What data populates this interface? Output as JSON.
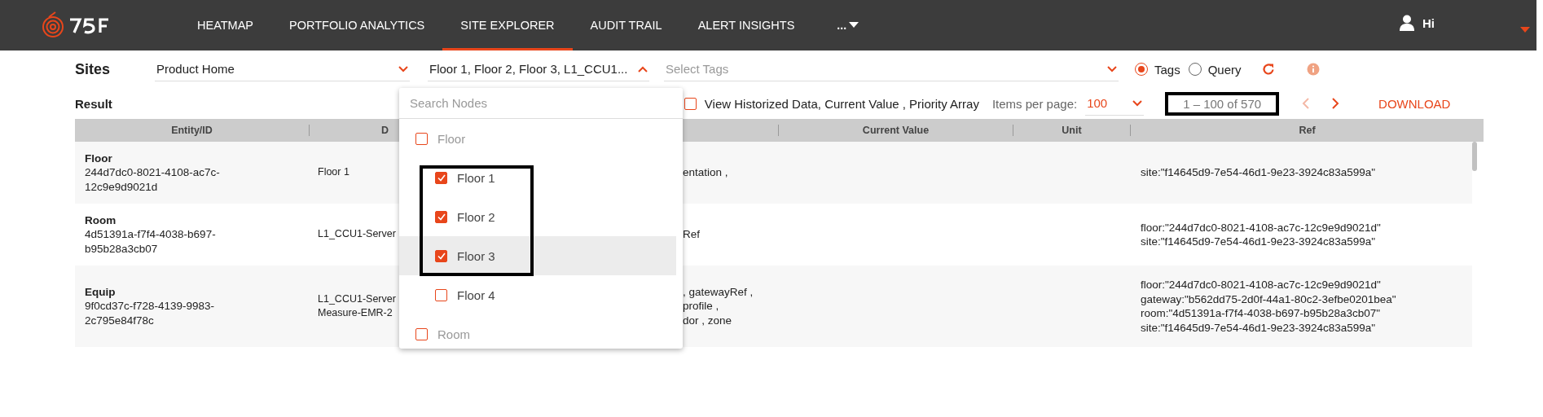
{
  "nav": {
    "items": [
      {
        "label": "HEATMAP",
        "selected": false,
        "kind": "link"
      },
      {
        "label": "PORTFOLIO ANALYTICS",
        "selected": false,
        "kind": "link"
      },
      {
        "label": "SITE EXPLORER",
        "selected": true,
        "kind": "link"
      },
      {
        "label": "AUDIT TRAIL",
        "selected": false,
        "kind": "link"
      },
      {
        "label": "ALERT INSIGHTS",
        "selected": false,
        "kind": "link"
      },
      {
        "label": "...",
        "selected": false,
        "kind": "more"
      }
    ],
    "user": "Hi"
  },
  "filters": {
    "title": "Sites",
    "site": "Product Home",
    "nodes": {
      "value": "Floor 1, Floor 2, Floor 3, L1_CCU1...",
      "expanded": true
    },
    "tags": {
      "placeholder": "Select Tags"
    },
    "modes": [
      {
        "label": "Tags",
        "selected": true
      },
      {
        "label": "Query",
        "selected": false
      }
    ]
  },
  "result": {
    "title": "Result",
    "historized": {
      "label": "View Historized Data, Current Value , Priority Array",
      "checked": false
    },
    "items_per_page": {
      "label": "Items per page:",
      "value": "100"
    },
    "range": "1 – 100 of 570",
    "prev_disabled": true,
    "download": "DOWNLOAD"
  },
  "node_dropdown": {
    "search": {
      "placeholder": "Search Nodes"
    },
    "options": [
      {
        "label": "Floor",
        "checked": false,
        "children": [
          {
            "label": "Floor 1",
            "checked": true,
            "highlighted": false
          },
          {
            "label": "Floor 2",
            "checked": true,
            "highlighted": false
          },
          {
            "label": "Floor 3",
            "checked": true,
            "highlighted": true
          },
          {
            "label": "Floor 4",
            "checked": false,
            "highlighted": false
          }
        ]
      },
      {
        "label": "Room",
        "checked": false
      }
    ]
  },
  "table": {
    "columns": {
      "entity": "Entity/ID",
      "column_2": "D",
      "current_value": "Current Value",
      "unit": "Unit",
      "ref": "Ref"
    },
    "rows": [
      {
        "type": "Floor",
        "id": "244d7dc0-8021-4108-ac7c-12c9e9d9021d",
        "column_2": [
          "Floor 1"
        ],
        "column_3": [
          "entation ,"
        ],
        "ref": [
          "site:\"f14645d9-7e54-46d1-9e23-3924c83a599a\""
        ]
      },
      {
        "type": "Room",
        "id": "4d51391a-f7f4-4038-b697-b95b28a3cb07",
        "column_2": [
          "L1_CCU1-Server"
        ],
        "column_3": [
          "Ref"
        ],
        "ref": [
          "floor:\"244d7dc0-8021-4108-ac7c-12c9e9d9021d\"",
          "site:\"f14645d9-7e54-46d1-9e23-3924c83a599a\""
        ]
      },
      {
        "type": "Equip",
        "id": "9f0cd37c-f728-4139-9983-2c795e84f78c",
        "column_2": [
          "L1_CCU1-Server",
          "Measure-EMR-2"
        ],
        "column_3": [
          ", gatewayRef ,",
          "profile ,",
          "dor , zone"
        ],
        "ref": [
          "floor:\"244d7dc0-8021-4108-ac7c-12c9e9d9021d\"",
          "gateway:\"b562dd75-2d0f-44a1-80c2-3efbe0201bea\"",
          "room:\"4d51391a-f7f4-4038-b697-b95b28a3cb07\"",
          "site:\"f14645d9-7e54-46d1-9e23-3924c83a599a\""
        ]
      }
    ]
  }
}
